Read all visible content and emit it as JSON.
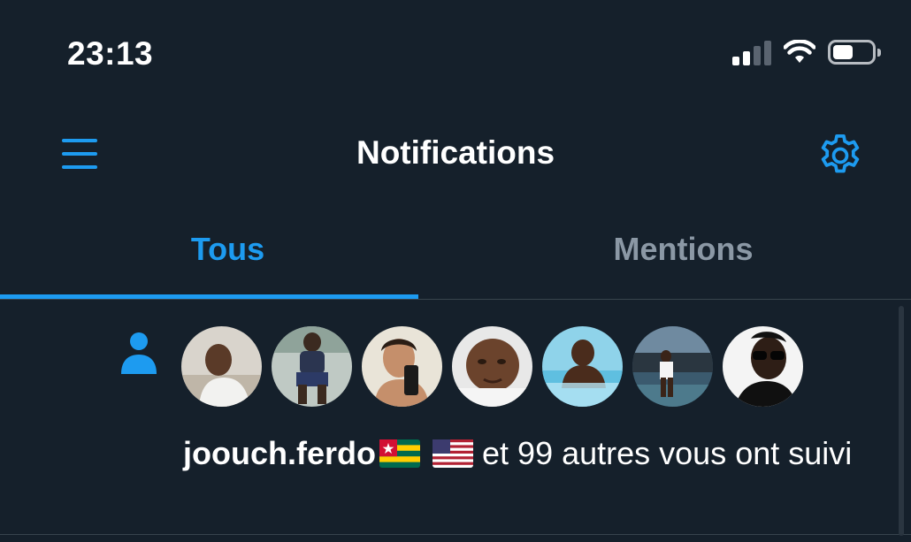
{
  "status_bar": {
    "time": "23:13",
    "signal_icon": "cellular-signal-icon",
    "wifi_icon": "wifi-icon",
    "battery_icon": "battery-icon"
  },
  "header": {
    "title": "Notifications",
    "menu_icon": "hamburger-menu-icon",
    "settings_icon": "gear-icon"
  },
  "tabs": [
    {
      "label": "Tous",
      "active": true
    },
    {
      "label": "Mentions",
      "active": false
    }
  ],
  "notification": {
    "type_icon": "person-follow-icon",
    "avatar_count": 7,
    "username": "joouch.ferdo",
    "flags": [
      "flag-togo-icon",
      "flag-usa-icon"
    ],
    "message": " et 99 autres vous ont suivi"
  },
  "colors": {
    "background": "#15202b",
    "accent": "#1d9bf0",
    "muted": "#8b98a5",
    "divider": "#38444d"
  }
}
